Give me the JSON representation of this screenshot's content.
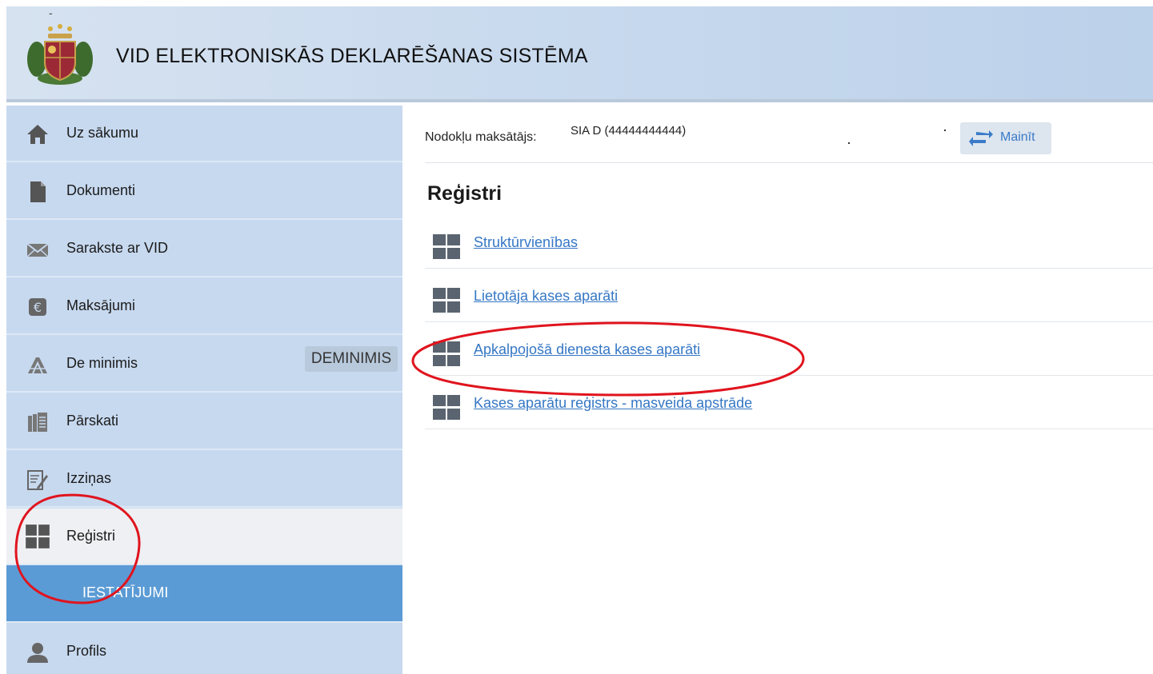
{
  "header": {
    "title": "VID ELEKTRONISKĀS DEKLARĒŠANAS SISTĒMA",
    "logo_icon": "coat-of-arms-icon"
  },
  "sidebar": {
    "items": [
      {
        "label": "Uz sākumu",
        "icon": "home-icon"
      },
      {
        "label": "Dokumenti",
        "icon": "document-icon"
      },
      {
        "label": "Sarakste ar VID",
        "icon": "envelope-icon"
      },
      {
        "label": "Maksājumi",
        "icon": "euro-icon"
      },
      {
        "label": "De minimis",
        "icon": "de-minimis-icon",
        "badge": "DEMINIMIS"
      },
      {
        "label": "Pārskati",
        "icon": "reports-icon"
      },
      {
        "label": "Izziņas",
        "icon": "certificate-icon"
      },
      {
        "label": "Reģistri",
        "icon": "grid-icon",
        "active": true
      },
      {
        "label": "IESTATĪJUMI",
        "icon": "",
        "highlight_color": "#5b9bd5"
      },
      {
        "label": "Profils",
        "icon": "user-icon"
      }
    ]
  },
  "taxpayer": {
    "label": "Nodokļu maksātājs:",
    "value": "SIA D (44444444444)",
    "change_label": "Mainīt"
  },
  "main": {
    "title": "Reģistri",
    "links": [
      {
        "label": "Struktūrvienības"
      },
      {
        "label": "Lietotāja kases aparāti"
      },
      {
        "label": "Apkalpojošā dienesta kases aparāti"
      },
      {
        "label": "Kases aparātu reģistrs - masveida apstrāde"
      }
    ]
  },
  "colors": {
    "sidebar_bg": "#c7d9ef",
    "active_bg": "#eef0f3",
    "settings_bg": "#5b9bd5",
    "link": "#3577c4",
    "annotation": "#e0141e"
  }
}
